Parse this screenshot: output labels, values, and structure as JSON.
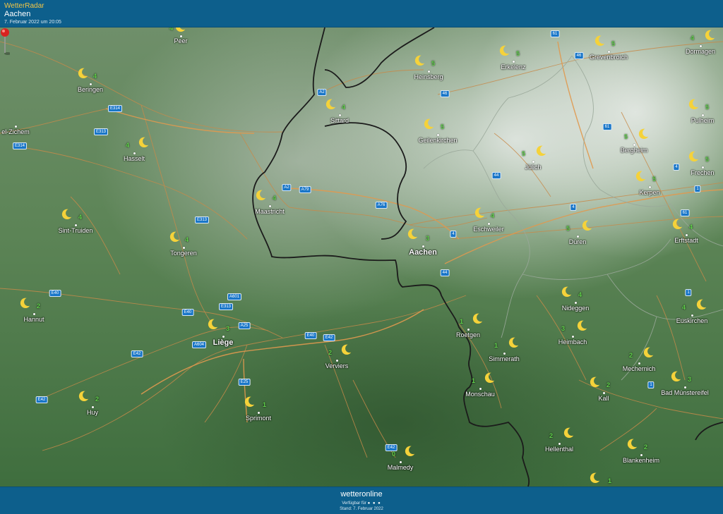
{
  "header": {
    "app_name": "WetterRadar",
    "location": "Aachen",
    "timestamp": "7. Februar 2022 um 20:05"
  },
  "footer": {
    "brand": "wetteronline",
    "availability": "Verfügbar für",
    "availability_dots": "● ● ●",
    "stand": "Stand: 7. Februar 2022"
  },
  "cities": [
    {
      "name": "Peer",
      "wind": "4"
    },
    {
      "name": "Beringen",
      "wind": "4"
    },
    {
      "name": "el-Zichem",
      "wind": ""
    },
    {
      "name": "Hasselt",
      "wind": "4"
    },
    {
      "name": "Sint-Truiden",
      "wind": "4"
    },
    {
      "name": "Tongeren",
      "wind": "4"
    },
    {
      "name": "Hannut",
      "wind": "2"
    },
    {
      "name": "Huy",
      "wind": "2"
    },
    {
      "name": "Liège",
      "wind": "3"
    },
    {
      "name": "Sprimont",
      "wind": "1"
    },
    {
      "name": "Verviers",
      "wind": "2"
    },
    {
      "name": "Malmedy",
      "wind": "0"
    },
    {
      "name": "Maastricht",
      "wind": "4"
    },
    {
      "name": "Sittard",
      "wind": "4"
    },
    {
      "name": "Heinsberg",
      "wind": "5"
    },
    {
      "name": "Erkelenz",
      "wind": "5"
    },
    {
      "name": "Geilenkirchen",
      "wind": "5"
    },
    {
      "name": "Jülich",
      "wind": "5"
    },
    {
      "name": "Aachen",
      "wind": "3"
    },
    {
      "name": "Eschweiler",
      "wind": "4"
    },
    {
      "name": "Düren",
      "wind": "5"
    },
    {
      "name": "Roetgen",
      "wind": "1"
    },
    {
      "name": "Simmerath",
      "wind": "1"
    },
    {
      "name": "Monschau",
      "wind": "1"
    },
    {
      "name": "Nideggen",
      "wind": "4"
    },
    {
      "name": "Heimbach",
      "wind": "3"
    },
    {
      "name": "Hellenthal",
      "wind": "2"
    },
    {
      "name": "Mechernich",
      "wind": "2"
    },
    {
      "name": "Kall",
      "wind": "2"
    },
    {
      "name": "Blankenheim",
      "wind": "2"
    },
    {
      "name": "Euskirchen",
      "wind": "4"
    },
    {
      "name": "Bad Münstereifel",
      "wind": "3"
    },
    {
      "name": "Erftstadt",
      "wind": "4"
    },
    {
      "name": "Kerpen",
      "wind": "5"
    },
    {
      "name": "Bergheim",
      "wind": "5"
    },
    {
      "name": "Grevenbroich",
      "wind": "5"
    },
    {
      "name": "Dormagen",
      "wind": "4"
    },
    {
      "name": "Pulheim",
      "wind": "5"
    },
    {
      "name": "Frechen",
      "wind": "5"
    },
    {
      "name": "",
      "wind": "1"
    }
  ],
  "roads": [
    "E314",
    "E313",
    "E314",
    "A2",
    "A2",
    "A79",
    "A76",
    "E313",
    "A601",
    "E313",
    "A25",
    "E40",
    "E40",
    "A604",
    "E42",
    "E25",
    "E42",
    "E42",
    "E40",
    "E42",
    "61",
    "46",
    "46",
    "61",
    "44",
    "4",
    "4",
    "4",
    "44",
    "61",
    "1",
    "1",
    "1"
  ],
  "colors": {
    "header_bg": "#0d5f8c",
    "accent": "#f3c646",
    "wind_text": "#5fd14a",
    "moon": "#f5d23a",
    "road_shield": "#1976c8",
    "pin": "#d8231f"
  }
}
